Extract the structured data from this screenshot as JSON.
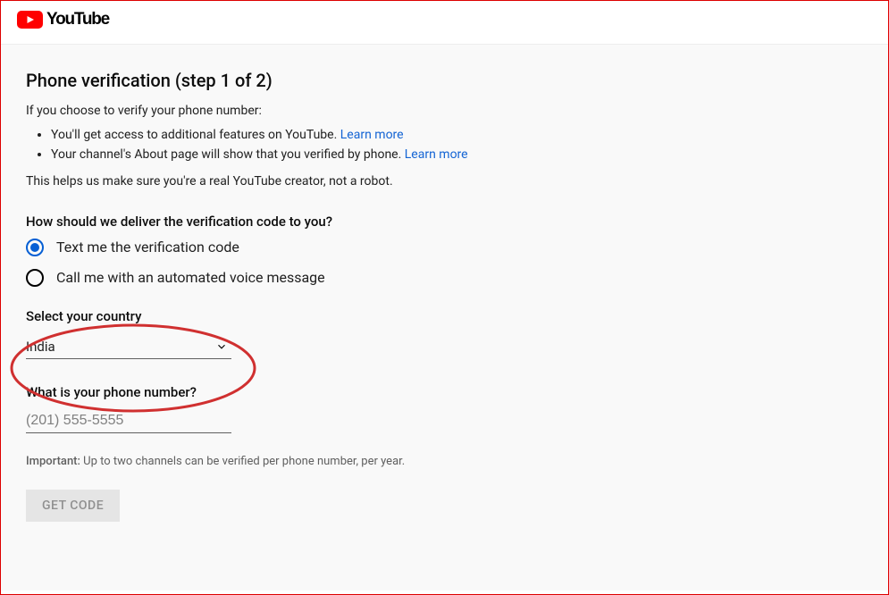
{
  "brand": {
    "name": "YouTube"
  },
  "page": {
    "title": "Phone verification (step 1 of 2)",
    "intro": "If you choose to verify your phone number:",
    "bullets": [
      {
        "text": "You'll get access to additional features on YouTube. ",
        "link": "Learn more"
      },
      {
        "text": "Your channel's About page will show that you verified by phone. ",
        "link": "Learn more"
      }
    ],
    "helps": "This helps us make sure you're a real YouTube creator, not a robot."
  },
  "delivery": {
    "label": "How should we deliver the verification code to you?",
    "options": [
      "Text me the verification code",
      "Call me with an automated voice message"
    ]
  },
  "country": {
    "label": "Select your country",
    "value": "India"
  },
  "phone": {
    "label": "What is your phone number?",
    "placeholder": "(201) 555-5555"
  },
  "note": {
    "bold": "Important:",
    "text": " Up to two channels can be verified per phone number, per year."
  },
  "button": {
    "get_code": "GET CODE"
  }
}
